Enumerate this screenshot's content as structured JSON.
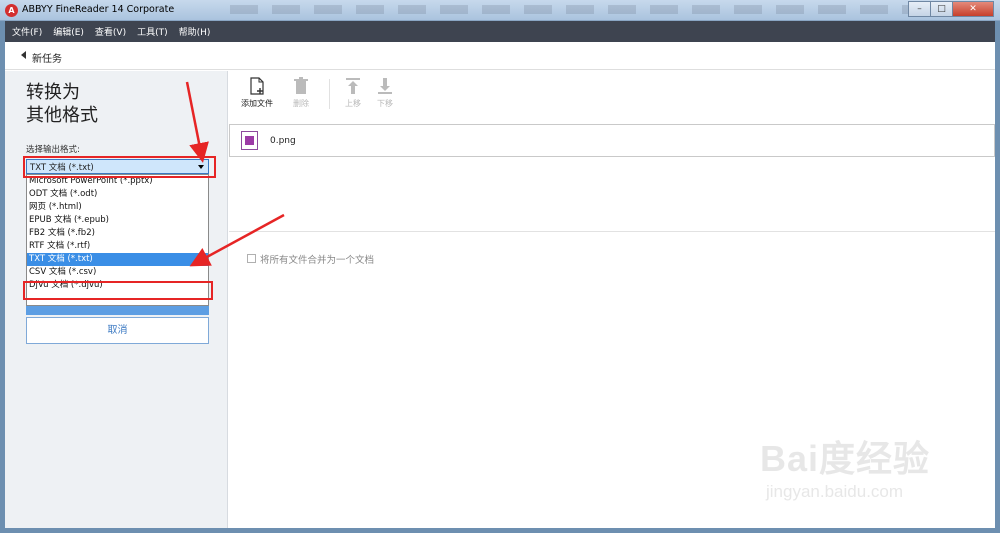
{
  "window": {
    "title": "ABBYY FineReader 14 Corporate",
    "app_icon_glyph": "A"
  },
  "menubar": {
    "items": [
      "文件(F)",
      "编辑(E)",
      "查看(V)",
      "工具(T)",
      "帮助(H)"
    ]
  },
  "nav": {
    "back_label": "新任务"
  },
  "left": {
    "title": "转换为\n其他格式",
    "format_label": "选择输出格式:",
    "selected_format": "TXT 文档 (*.txt)",
    "options": [
      "Microsoft PowerPoint (*.pptx)",
      "ODT 文档 (*.odt)",
      "网页 (*.html)",
      "EPUB 文档 (*.epub)",
      "FB2 文档 (*.fb2)",
      "RTF 文档 (*.rtf)",
      "TXT 文档 (*.txt)",
      "CSV 文档 (*.csv)",
      "DjVu 文档 (*.djvu)"
    ],
    "highlighted_option": "TXT 文档 (*.txt)",
    "cancel_label": "取消"
  },
  "toolbar": {
    "add_file": "添加文件",
    "delete": "删除",
    "move_up": "上移",
    "move_down": "下移"
  },
  "files": [
    {
      "name": "0.png"
    }
  ],
  "merge_label": "将所有文件合并为一个文档",
  "watermark": {
    "logo": "Bai度经验",
    "url": "jingyan.baidu.com"
  },
  "colors": {
    "accent": "#3a8ee6",
    "menubar": "#3e4450",
    "annotation": "#e62525",
    "file_icon": "#9c3aa6"
  }
}
